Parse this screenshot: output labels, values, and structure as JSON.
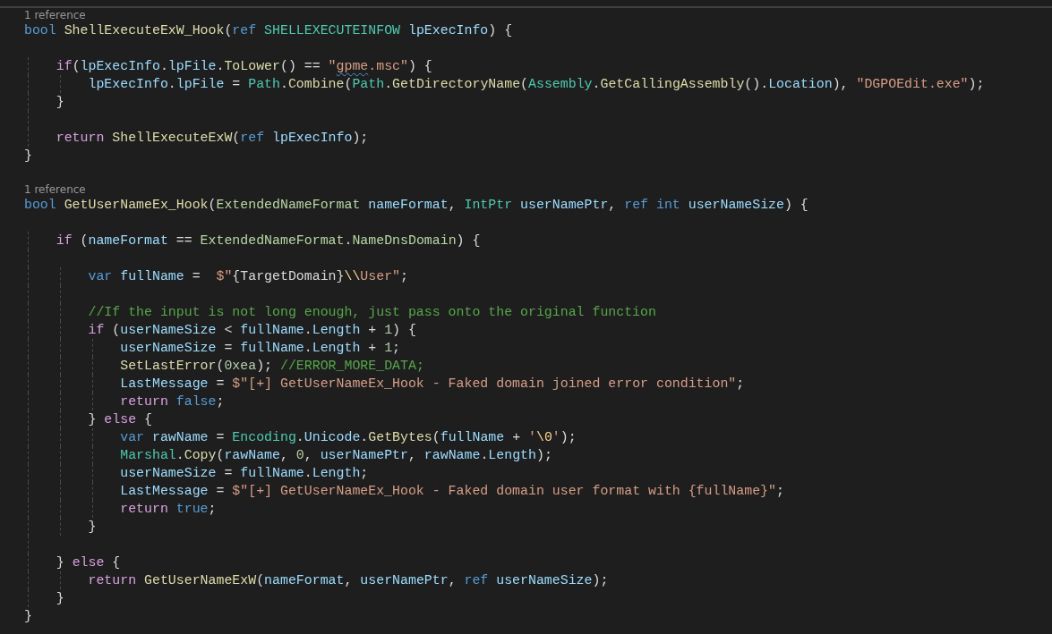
{
  "editor": {
    "lines": [
      {
        "kind": "codelens",
        "text": "1 reference"
      },
      {
        "kind": "code",
        "tokens": [
          {
            "text": "bool",
            "kind": "kw"
          },
          {
            "text": " ShellExecuteExW_Hook",
            "kind": "fn"
          },
          {
            "text": "(",
            "kind": "plain"
          },
          {
            "text": "ref",
            "kind": "kw"
          },
          {
            "text": " SHELLEXECUTEINFOW",
            "kind": "type"
          },
          {
            "text": " lpExecInfo",
            "kind": "var"
          },
          {
            "text": ") {",
            "kind": "plain"
          }
        ]
      },
      {
        "kind": "blank"
      },
      {
        "kind": "code",
        "tokens": [
          {
            "text": "    if",
            "kind": "ctl"
          },
          {
            "text": "(",
            "kind": "plain"
          },
          {
            "text": "lpExecInfo",
            "kind": "var"
          },
          {
            "text": ".",
            "kind": "plain"
          },
          {
            "text": "lpFile",
            "kind": "var"
          },
          {
            "text": ".",
            "kind": "plain"
          },
          {
            "text": "ToLower",
            "kind": "fn"
          },
          {
            "text": "() == ",
            "kind": "plain"
          },
          {
            "text": "\"",
            "kind": "str"
          },
          {
            "text": "gpme",
            "kind": "misspelled"
          },
          {
            "text": ".msc\"",
            "kind": "str"
          },
          {
            "text": ") {",
            "kind": "plain"
          }
        ]
      },
      {
        "kind": "code",
        "tokens": [
          {
            "text": "        lpExecInfo",
            "kind": "var"
          },
          {
            "text": ".",
            "kind": "plain"
          },
          {
            "text": "lpFile",
            "kind": "var"
          },
          {
            "text": " = ",
            "kind": "plain"
          },
          {
            "text": "Path",
            "kind": "type"
          },
          {
            "text": ".",
            "kind": "plain"
          },
          {
            "text": "Combine",
            "kind": "fn"
          },
          {
            "text": "(",
            "kind": "plain"
          },
          {
            "text": "Path",
            "kind": "type"
          },
          {
            "text": ".",
            "kind": "plain"
          },
          {
            "text": "GetDirectoryName",
            "kind": "fn"
          },
          {
            "text": "(",
            "kind": "plain"
          },
          {
            "text": "Assembly",
            "kind": "type"
          },
          {
            "text": ".",
            "kind": "plain"
          },
          {
            "text": "GetCallingAssembly",
            "kind": "fn"
          },
          {
            "text": "().",
            "kind": "plain"
          },
          {
            "text": "Location",
            "kind": "var"
          },
          {
            "text": "), ",
            "kind": "plain"
          },
          {
            "text": "\"DGPOEdit.exe\"",
            "kind": "str"
          },
          {
            "text": ");",
            "kind": "plain"
          }
        ]
      },
      {
        "kind": "code",
        "tokens": [
          {
            "text": "    }",
            "kind": "plain"
          }
        ]
      },
      {
        "kind": "blank"
      },
      {
        "kind": "code",
        "tokens": [
          {
            "text": "    return",
            "kind": "ctl"
          },
          {
            "text": " ShellExecuteExW",
            "kind": "fn"
          },
          {
            "text": "(",
            "kind": "plain"
          },
          {
            "text": "ref",
            "kind": "kw"
          },
          {
            "text": " lpExecInfo",
            "kind": "var"
          },
          {
            "text": ");",
            "kind": "plain"
          }
        ]
      },
      {
        "kind": "code",
        "tokens": [
          {
            "text": "}",
            "kind": "plain"
          }
        ]
      },
      {
        "kind": "blank"
      },
      {
        "kind": "codelens",
        "text": "1 reference"
      },
      {
        "kind": "code",
        "tokens": [
          {
            "text": "bool",
            "kind": "kw"
          },
          {
            "text": " GetUserNameEx_Hook",
            "kind": "fn"
          },
          {
            "text": "(",
            "kind": "plain"
          },
          {
            "text": "ExtendedNameFormat",
            "kind": "enum"
          },
          {
            "text": " nameFormat",
            "kind": "var"
          },
          {
            "text": ", ",
            "kind": "plain"
          },
          {
            "text": "IntPtr",
            "kind": "type"
          },
          {
            "text": " userNamePtr",
            "kind": "var"
          },
          {
            "text": ", ",
            "kind": "plain"
          },
          {
            "text": "ref int",
            "kind": "kw"
          },
          {
            "text": " userNameSize",
            "kind": "var"
          },
          {
            "text": ") {",
            "kind": "plain"
          }
        ]
      },
      {
        "kind": "blank"
      },
      {
        "kind": "code",
        "tokens": [
          {
            "text": "    if",
            "kind": "ctl"
          },
          {
            "text": " (",
            "kind": "plain"
          },
          {
            "text": "nameFormat",
            "kind": "var"
          },
          {
            "text": " == ",
            "kind": "plain"
          },
          {
            "text": "ExtendedNameFormat",
            "kind": "enum"
          },
          {
            "text": ".",
            "kind": "plain"
          },
          {
            "text": "NameDnsDomain",
            "kind": "enum"
          },
          {
            "text": ") {",
            "kind": "plain"
          }
        ]
      },
      {
        "kind": "blank"
      },
      {
        "kind": "code",
        "tokens": [
          {
            "text": "        var",
            "kind": "kw"
          },
          {
            "text": " fullName",
            "kind": "var"
          },
          {
            "text": " =  ",
            "kind": "plain"
          },
          {
            "text": "$\"",
            "kind": "str"
          },
          {
            "text": "{TargetDomain}",
            "kind": "plain"
          },
          {
            "text": "\\\\",
            "kind": "esc"
          },
          {
            "text": "User\"",
            "kind": "str"
          },
          {
            "text": ";",
            "kind": "plain"
          }
        ]
      },
      {
        "kind": "blank"
      },
      {
        "kind": "code",
        "tokens": [
          {
            "text": "        //If the input is not long enough, just pass onto the original function",
            "kind": "cmt"
          }
        ]
      },
      {
        "kind": "code",
        "tokens": [
          {
            "text": "        if",
            "kind": "ctl"
          },
          {
            "text": " (",
            "kind": "plain"
          },
          {
            "text": "userNameSize",
            "kind": "var"
          },
          {
            "text": " < ",
            "kind": "plain"
          },
          {
            "text": "fullName",
            "kind": "var"
          },
          {
            "text": ".",
            "kind": "plain"
          },
          {
            "text": "Length",
            "kind": "var"
          },
          {
            "text": " + ",
            "kind": "plain"
          },
          {
            "text": "1",
            "kind": "num"
          },
          {
            "text": ") {",
            "kind": "plain"
          }
        ]
      },
      {
        "kind": "code",
        "tokens": [
          {
            "text": "            userNameSize",
            "kind": "var"
          },
          {
            "text": " = ",
            "kind": "plain"
          },
          {
            "text": "fullName",
            "kind": "var"
          },
          {
            "text": ".",
            "kind": "plain"
          },
          {
            "text": "Length",
            "kind": "var"
          },
          {
            "text": " + ",
            "kind": "plain"
          },
          {
            "text": "1",
            "kind": "num"
          },
          {
            "text": ";",
            "kind": "plain"
          }
        ]
      },
      {
        "kind": "code",
        "tokens": [
          {
            "text": "            SetLastError",
            "kind": "fn"
          },
          {
            "text": "(",
            "kind": "plain"
          },
          {
            "text": "0xea",
            "kind": "num"
          },
          {
            "text": "); ",
            "kind": "plain"
          },
          {
            "text": "//ERROR_MORE_DATA;",
            "kind": "cmt"
          }
        ]
      },
      {
        "kind": "code",
        "tokens": [
          {
            "text": "            LastMessage",
            "kind": "var"
          },
          {
            "text": " = ",
            "kind": "plain"
          },
          {
            "text": "$\"[+] GetUserNameEx_Hook - Faked domain joined error condition\"",
            "kind": "str"
          },
          {
            "text": ";",
            "kind": "plain"
          }
        ]
      },
      {
        "kind": "code",
        "tokens": [
          {
            "text": "            return",
            "kind": "ctl"
          },
          {
            "text": " false",
            "kind": "kw"
          },
          {
            "text": ";",
            "kind": "plain"
          }
        ]
      },
      {
        "kind": "code",
        "tokens": [
          {
            "text": "        } ",
            "kind": "plain"
          },
          {
            "text": "else",
            "kind": "ctl"
          },
          {
            "text": " {",
            "kind": "plain"
          }
        ]
      },
      {
        "kind": "code",
        "tokens": [
          {
            "text": "            var",
            "kind": "kw"
          },
          {
            "text": " rawName",
            "kind": "var"
          },
          {
            "text": " = ",
            "kind": "plain"
          },
          {
            "text": "Encoding",
            "kind": "type"
          },
          {
            "text": ".",
            "kind": "plain"
          },
          {
            "text": "Unicode",
            "kind": "var"
          },
          {
            "text": ".",
            "kind": "plain"
          },
          {
            "text": "GetBytes",
            "kind": "fn"
          },
          {
            "text": "(",
            "kind": "plain"
          },
          {
            "text": "fullName",
            "kind": "var"
          },
          {
            "text": " + ",
            "kind": "plain"
          },
          {
            "text": "'",
            "kind": "str"
          },
          {
            "text": "\\0",
            "kind": "esc"
          },
          {
            "text": "'",
            "kind": "str"
          },
          {
            "text": ");",
            "kind": "plain"
          }
        ]
      },
      {
        "kind": "code",
        "tokens": [
          {
            "text": "            Marshal",
            "kind": "type"
          },
          {
            "text": ".",
            "kind": "plain"
          },
          {
            "text": "Copy",
            "kind": "fn"
          },
          {
            "text": "(",
            "kind": "plain"
          },
          {
            "text": "rawName",
            "kind": "var"
          },
          {
            "text": ", ",
            "kind": "plain"
          },
          {
            "text": "0",
            "kind": "num"
          },
          {
            "text": ", ",
            "kind": "plain"
          },
          {
            "text": "userNamePtr",
            "kind": "var"
          },
          {
            "text": ", ",
            "kind": "plain"
          },
          {
            "text": "rawName",
            "kind": "var"
          },
          {
            "text": ".",
            "kind": "plain"
          },
          {
            "text": "Length",
            "kind": "var"
          },
          {
            "text": ");",
            "kind": "plain"
          }
        ]
      },
      {
        "kind": "code",
        "tokens": [
          {
            "text": "            userNameSize",
            "kind": "var"
          },
          {
            "text": " = ",
            "kind": "plain"
          },
          {
            "text": "fullName",
            "kind": "var"
          },
          {
            "text": ".",
            "kind": "plain"
          },
          {
            "text": "Length",
            "kind": "var"
          },
          {
            "text": ";",
            "kind": "plain"
          }
        ]
      },
      {
        "kind": "code",
        "tokens": [
          {
            "text": "            LastMessage",
            "kind": "var"
          },
          {
            "text": " = ",
            "kind": "plain"
          },
          {
            "text": "$\"[+] GetUserNameEx_Hook - Faked domain user format with {fullName}\"",
            "kind": "str"
          },
          {
            "text": ";",
            "kind": "plain"
          }
        ]
      },
      {
        "kind": "code",
        "tokens": [
          {
            "text": "            return",
            "kind": "ctl"
          },
          {
            "text": " true",
            "kind": "kw"
          },
          {
            "text": ";",
            "kind": "plain"
          }
        ]
      },
      {
        "kind": "code",
        "tokens": [
          {
            "text": "        }",
            "kind": "plain"
          }
        ]
      },
      {
        "kind": "blank"
      },
      {
        "kind": "code",
        "tokens": [
          {
            "text": "    } ",
            "kind": "plain"
          },
          {
            "text": "else",
            "kind": "ctl"
          },
          {
            "text": " {",
            "kind": "plain"
          }
        ]
      },
      {
        "kind": "code",
        "tokens": [
          {
            "text": "        return",
            "kind": "ctl"
          },
          {
            "text": " GetUserNameExW",
            "kind": "fn"
          },
          {
            "text": "(",
            "kind": "plain"
          },
          {
            "text": "nameFormat",
            "kind": "var"
          },
          {
            "text": ", ",
            "kind": "plain"
          },
          {
            "text": "userNamePtr",
            "kind": "var"
          },
          {
            "text": ", ",
            "kind": "plain"
          },
          {
            "text": "ref",
            "kind": "kw"
          },
          {
            "text": " userNameSize",
            "kind": "var"
          },
          {
            "text": ");",
            "kind": "plain"
          }
        ]
      },
      {
        "kind": "code",
        "tokens": [
          {
            "text": "    }",
            "kind": "plain"
          }
        ]
      },
      {
        "kind": "code",
        "tokens": [
          {
            "text": "}",
            "kind": "plain"
          }
        ]
      }
    ]
  }
}
